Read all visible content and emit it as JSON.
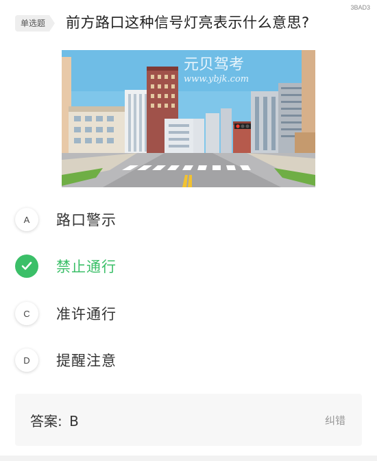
{
  "question_id": "3BAD3",
  "question_type": "单选题",
  "question_text": "前方路口这种信号灯亮表示什么意思?",
  "image": {
    "watermark_title": "元贝驾考",
    "watermark_url": "www.ybjk.com"
  },
  "options": [
    {
      "letter": "A",
      "text": "路口警示",
      "state": "normal"
    },
    {
      "letter": "B",
      "text": "禁止通行",
      "state": "correct",
      "icon": "check-icon"
    },
    {
      "letter": "C",
      "text": "准许通行",
      "state": "normal"
    },
    {
      "letter": "D",
      "text": "提醒注意",
      "state": "normal"
    }
  ],
  "answer": {
    "label": "答案:",
    "value": "B",
    "report_label": "纠错"
  },
  "colors": {
    "correct": "#3bbf68",
    "sky": "#7fc6ea",
    "road": "#a8a8aa"
  }
}
